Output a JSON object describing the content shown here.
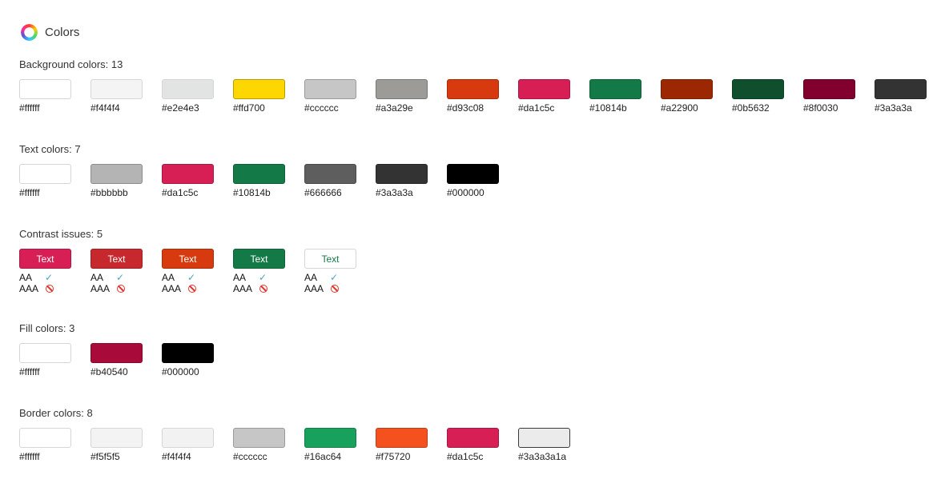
{
  "header": {
    "title": "Colors",
    "icon": "color-wheel-icon"
  },
  "background": {
    "title": "Background colors: 13",
    "items": [
      {
        "hex": "#ffffff",
        "color": "#ffffff"
      },
      {
        "hex": "#f4f4f4",
        "color": "#f4f4f4"
      },
      {
        "hex": "#e2e4e3",
        "color": "#e2e4e3"
      },
      {
        "hex": "#ffd700",
        "color": "#ffd700"
      },
      {
        "hex": "#cccccc",
        "color": "#c6c6c6"
      },
      {
        "hex": "#a3a29e",
        "color": "#9c9b97"
      },
      {
        "hex": "#d93c08",
        "color": "#d63a0e"
      },
      {
        "hex": "#da1c5c",
        "color": "#d71e55"
      },
      {
        "hex": "#10814b",
        "color": "#137a47"
      },
      {
        "hex": "#a22900",
        "color": "#9b2803"
      },
      {
        "hex": "#0b5632",
        "color": "#0f4f2e"
      },
      {
        "hex": "#8f0030",
        "color": "#82002e"
      },
      {
        "hex": "#3a3a3a",
        "color": "#333333"
      }
    ]
  },
  "text": {
    "title": "Text colors: 7",
    "items": [
      {
        "hex": "#ffffff",
        "color": "#ffffff"
      },
      {
        "hex": "#bbbbbb",
        "color": "#b4b4b4"
      },
      {
        "hex": "#da1c5c",
        "color": "#d71e55"
      },
      {
        "hex": "#10814b",
        "color": "#137a47"
      },
      {
        "hex": "#666666",
        "color": "#5e5e5e"
      },
      {
        "hex": "#3a3a3a",
        "color": "#333333"
      },
      {
        "hex": "#000000",
        "color": "#000000"
      }
    ]
  },
  "contrast": {
    "title": "Contrast issues: 5",
    "aa_label": "AA",
    "aaa_label": "AAA",
    "items": [
      {
        "label": "Text",
        "bg": "#d71e55",
        "fg": "#ffffff",
        "aa": "pass",
        "aaa": "fail"
      },
      {
        "label": "Text",
        "bg": "#c6282d",
        "fg": "#ffffff",
        "aa": "pass",
        "aaa": "fail"
      },
      {
        "label": "Text",
        "bg": "#d63a0e",
        "fg": "#ffffff",
        "aa": "pass",
        "aaa": "fail"
      },
      {
        "label": "Text",
        "bg": "#137a47",
        "fg": "#ffffff",
        "aa": "pass",
        "aaa": "fail"
      },
      {
        "label": "Text",
        "bg": "#ffffff",
        "fg": "#137a47",
        "aa": "pass",
        "aaa": "fail"
      }
    ]
  },
  "fill": {
    "title": "Fill colors: 3",
    "items": [
      {
        "hex": "#ffffff",
        "color": "#ffffff"
      },
      {
        "hex": "#b40540",
        "color": "#a80a3a"
      },
      {
        "hex": "#000000",
        "color": "#000000"
      }
    ]
  },
  "border": {
    "title": "Border colors: 8",
    "items": [
      {
        "hex": "#ffffff",
        "color": "#ffffff"
      },
      {
        "hex": "#f5f5f5",
        "color": "#f3f3f3"
      },
      {
        "hex": "#f4f4f4",
        "color": "#f2f2f2"
      },
      {
        "hex": "#cccccc",
        "color": "#c6c6c6"
      },
      {
        "hex": "#16ac64",
        "color": "#17a15c"
      },
      {
        "hex": "#f75720",
        "color": "#f4511e"
      },
      {
        "hex": "#da1c5c",
        "color": "#d71e55"
      },
      {
        "hex": "#3a3a3a1a",
        "color": "#ebebeb",
        "dark_border": true
      }
    ]
  }
}
